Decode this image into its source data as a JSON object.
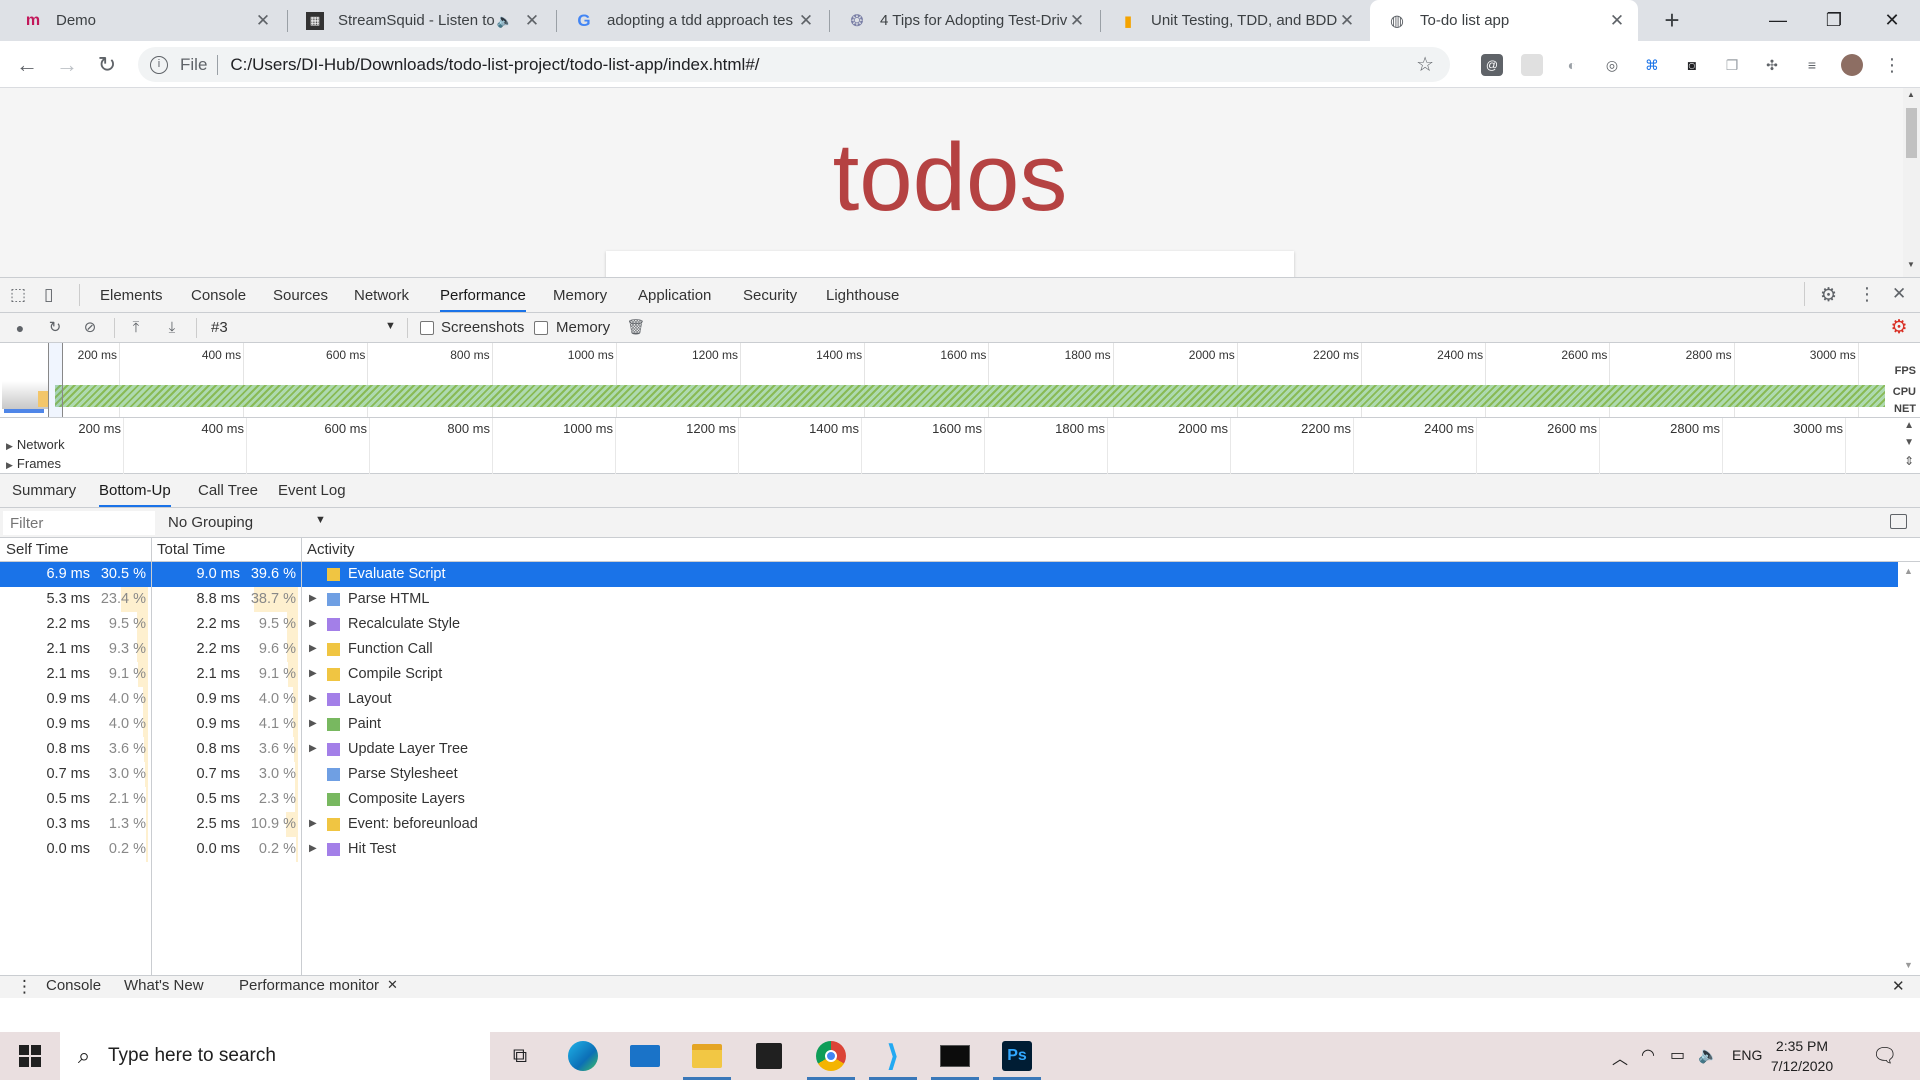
{
  "browser": {
    "tabs": [
      {
        "title": "Demo",
        "favicon": "m-icon",
        "active": false
      },
      {
        "title": "StreamSquid - Listen to F",
        "favicon": "streamsquid-icon",
        "active": false,
        "audio": true
      },
      {
        "title": "adopting a tdd approach tes",
        "favicon": "google-icon",
        "active": false
      },
      {
        "title": "4 Tips for Adopting Test-Driv",
        "favicon": "site-icon",
        "active": false
      },
      {
        "title": "Unit Testing, TDD, and BDD,",
        "favicon": "chart-icon",
        "active": false
      },
      {
        "title": "To-do list app",
        "favicon": "globe-icon",
        "active": true
      }
    ],
    "address": {
      "scheme_label": "File",
      "url": "C:/Users/DI-Hub/Downloads/todo-list-project/todo-list-app/index.html#/"
    }
  },
  "page": {
    "heading": "todos"
  },
  "devtools": {
    "tabs": [
      "Elements",
      "Console",
      "Sources",
      "Network",
      "Performance",
      "Memory",
      "Application",
      "Security",
      "Lighthouse"
    ],
    "active_tab": "Performance",
    "toolbar": {
      "recording": "#3",
      "screenshots_label": "Screenshots",
      "memory_label": "Memory"
    },
    "overview": {
      "ticks": [
        "200 ms",
        "400 ms",
        "600 ms",
        "800 ms",
        "1000 ms",
        "1200 ms",
        "1400 ms",
        "1600 ms",
        "1800 ms",
        "2000 ms",
        "2200 ms",
        "2400 ms",
        "2600 ms",
        "2800 ms",
        "3000 ms"
      ],
      "side_labels": [
        "FPS",
        "CPU",
        "NET"
      ]
    },
    "flame": {
      "ticks": [
        "200 ms",
        "400 ms",
        "600 ms",
        "800 ms",
        "1000 ms",
        "1200 ms",
        "1400 ms",
        "1600 ms",
        "1800 ms",
        "2000 ms",
        "2200 ms",
        "2400 ms",
        "2600 ms",
        "2800 ms",
        "3000 ms"
      ],
      "tracks": [
        "Network",
        "Frames"
      ]
    },
    "sub_tabs": [
      "Summary",
      "Bottom-Up",
      "Call Tree",
      "Event Log"
    ],
    "active_sub_tab": "Bottom-Up",
    "filter_placeholder": "Filter",
    "grouping": "No Grouping",
    "columns": [
      "Self Time",
      "Total Time",
      "Activity"
    ],
    "rows": [
      {
        "self": "6.9 ms",
        "self_pct": "30.5 %",
        "self_frac": 0.305,
        "total": "9.0 ms",
        "total_pct": "39.6 %",
        "total_frac": 0.396,
        "activity": "Evaluate Script",
        "color": "#f0c542",
        "expandable": false,
        "selected": true
      },
      {
        "self": "5.3 ms",
        "self_pct": "23.4 %",
        "self_frac": 0.234,
        "total": "8.8 ms",
        "total_pct": "38.7 %",
        "total_frac": 0.387,
        "activity": "Parse HTML",
        "color": "#6f9fe3",
        "expandable": true,
        "selected": false
      },
      {
        "self": "2.2 ms",
        "self_pct": "9.5 %",
        "self_frac": 0.095,
        "total": "2.2 ms",
        "total_pct": "9.5 %",
        "total_frac": 0.095,
        "activity": "Recalculate Style",
        "color": "#a37fe8",
        "expandable": true,
        "selected": false
      },
      {
        "self": "2.1 ms",
        "self_pct": "9.3 %",
        "self_frac": 0.093,
        "total": "2.2 ms",
        "total_pct": "9.6 %",
        "total_frac": 0.096,
        "activity": "Function Call",
        "color": "#f0c542",
        "expandable": true,
        "selected": false
      },
      {
        "self": "2.1 ms",
        "self_pct": "9.1 %",
        "self_frac": 0.091,
        "total": "2.1 ms",
        "total_pct": "9.1 %",
        "total_frac": 0.091,
        "activity": "Compile Script",
        "color": "#f0c542",
        "expandable": true,
        "selected": false
      },
      {
        "self": "0.9 ms",
        "self_pct": "4.0 %",
        "self_frac": 0.04,
        "total": "0.9 ms",
        "total_pct": "4.0 %",
        "total_frac": 0.04,
        "activity": "Layout",
        "color": "#a37fe8",
        "expandable": true,
        "selected": false
      },
      {
        "self": "0.9 ms",
        "self_pct": "4.0 %",
        "self_frac": 0.04,
        "total": "0.9 ms",
        "total_pct": "4.1 %",
        "total_frac": 0.041,
        "activity": "Paint",
        "color": "#78b860",
        "expandable": true,
        "selected": false
      },
      {
        "self": "0.8 ms",
        "self_pct": "3.6 %",
        "self_frac": 0.036,
        "total": "0.8 ms",
        "total_pct": "3.6 %",
        "total_frac": 0.036,
        "activity": "Update Layer Tree",
        "color": "#a37fe8",
        "expandable": true,
        "selected": false
      },
      {
        "self": "0.7 ms",
        "self_pct": "3.0 %",
        "self_frac": 0.03,
        "total": "0.7 ms",
        "total_pct": "3.0 %",
        "total_frac": 0.03,
        "activity": "Parse Stylesheet",
        "color": "#6f9fe3",
        "expandable": false,
        "selected": false
      },
      {
        "self": "0.5 ms",
        "self_pct": "2.1 %",
        "self_frac": 0.021,
        "total": "0.5 ms",
        "total_pct": "2.3 %",
        "total_frac": 0.023,
        "activity": "Composite Layers",
        "color": "#78b860",
        "expandable": false,
        "selected": false
      },
      {
        "self": "0.3 ms",
        "self_pct": "1.3 %",
        "self_frac": 0.013,
        "total": "2.5 ms",
        "total_pct": "10.9 %",
        "total_frac": 0.109,
        "activity": "Event: beforeunload",
        "color": "#f0c542",
        "expandable": true,
        "selected": false
      },
      {
        "self": "0.0 ms",
        "self_pct": "0.2 %",
        "self_frac": 0.002,
        "total": "0.0 ms",
        "total_pct": "0.2 %",
        "total_frac": 0.002,
        "activity": "Hit Test",
        "color": "#a37fe8",
        "expandable": true,
        "selected": false
      }
    ],
    "drawer_tabs": [
      "Console",
      "What's New",
      "Performance monitor"
    ]
  },
  "taskbar": {
    "search_placeholder": "Type here to search",
    "apps": [
      "task-view-icon",
      "edge-icon",
      "mail-icon",
      "file-explorer-icon",
      "store-icon",
      "chrome-icon",
      "vscode-icon",
      "terminal-icon",
      "photoshop-icon"
    ],
    "language": "ENG",
    "time": "2:35 PM",
    "date": "7/12/2020"
  }
}
